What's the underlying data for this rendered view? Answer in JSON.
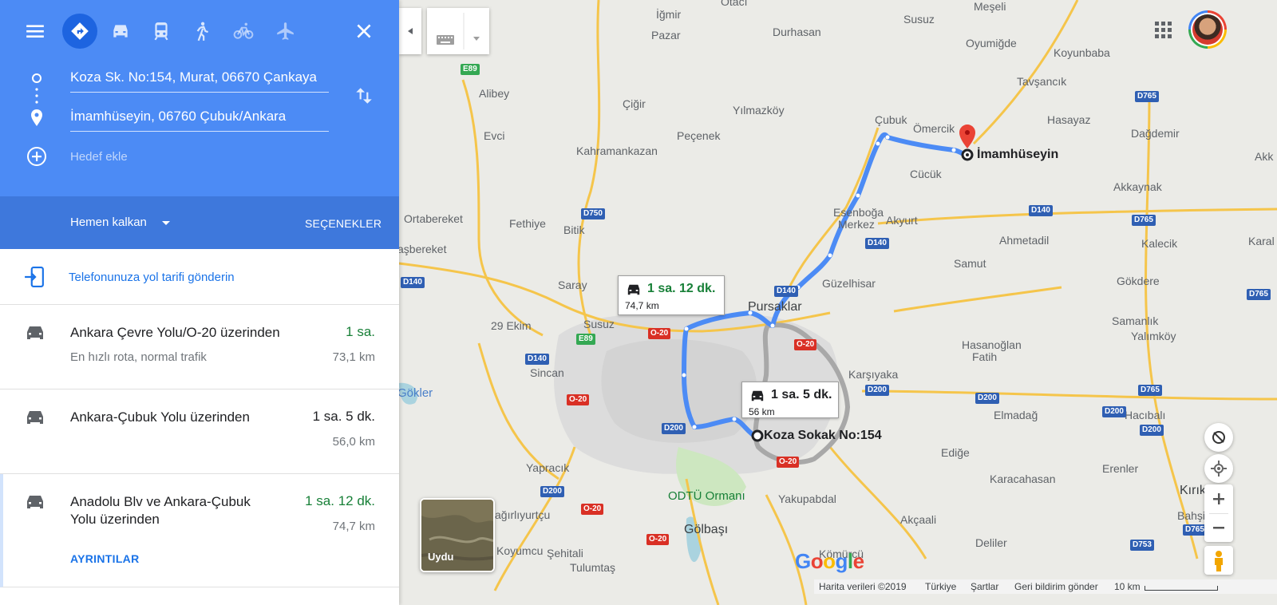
{
  "panel": {
    "origin_field": "Koza Sk. No:154, Murat, 06670 Çankaya",
    "destination_field": "İmamhüseyin, 06760 Çubuk/Ankara",
    "add_destination_placeholder": "Hedef ekle",
    "depart_label": "Hemen kalkan",
    "options_label": "SEÇENEKLER",
    "send_to_phone": "Telefonunuza yol tarifi gönderin",
    "routes": [
      {
        "name": "Ankara Çevre Yolu/O-20 üzerinden",
        "time": "1 sa.",
        "description": "En hızlı rota, normal trafik",
        "distance": "73,1 km"
      },
      {
        "name": "Ankara-Çubuk Yolu üzerinden",
        "time": "1 sa. 5 dk.",
        "description": "",
        "distance": "56,0 km"
      },
      {
        "name_line1": "Anadolu Blv ve Ankara-Çubuk",
        "name_line2": "Yolu üzerinden",
        "time": "1 sa. 12 dk.",
        "distance": "74,7 km",
        "details_label": "AYRINTILAR"
      }
    ],
    "modes": [
      "directions-icon",
      "car-icon",
      "transit-icon",
      "walk-icon",
      "bicycle-icon",
      "flight-icon"
    ]
  },
  "map": {
    "places": {
      "igmir": "İğmir",
      "otaci": "Otacı",
      "susuz": "Susuz",
      "mesel": "Meşeli",
      "pazar": "Pazar",
      "durhasan": "Durhasan",
      "oyumlu": "Oyumiğde",
      "koyun": "Koyunbaba",
      "alibey": "Alibey",
      "cigir": "Çiğir",
      "yilmaz": "Yılmazköy",
      "tavsan": "Tavşancık",
      "cubuk": "Çubuk",
      "omercik": "Ömercik",
      "hasayaz": "Hasayaz",
      "dagdemir": "Dağdemir",
      "evci": "Evci",
      "pecenek": "Peçenek",
      "kahraman": "Kahramankazan",
      "cucuk": "Cücük",
      "akka": "Akk",
      "akkaynak": "Akkaynak",
      "orta": "Ortabereket",
      "fethiye": "Fethiye",
      "bitik": "Bitik",
      "esenboga": "Esenboğa",
      "merkez": "Merkez",
      "akyurt": "Akyurt",
      "ahmetadil": "Ahmetadil",
      "kalecik": "Kalecik",
      "kara": "Karal",
      "asbereket": "aşbereket",
      "samut": "Samut",
      "saray": "Saray",
      "guzelhisar": "Güzelhisar",
      "gokdere": "Gökdere",
      "pursaklar": "Pursaklar",
      "ekim": "29 Ekim",
      "susuz2": "Susuz",
      "samanlik": "Samanlık",
      "hasanoglan": "Hasanoğlan",
      "fatih": "Fatih",
      "yalim": "Yalımköy",
      "sincan": "Sincan",
      "karsiyaka": "Karşıyaka",
      "gokler": "Gökler",
      "elmadag": "Elmadağ",
      "hacibali": "Hacıbalı",
      "yaprak": "Yapracık",
      "edige": "Ediğe",
      "erenler": "Erenler",
      "karaca": "Karacahasan",
      "kirik": "Kırık",
      "odtu": "ODTÜ Ormanı",
      "yakup": "Yakupabdal",
      "bahsili": "Bahşili",
      "sagir": "ağırlıyurtçu",
      "akcaali": "Akçaali",
      "golbasi": "Gölbaşı",
      "koyumcu": "Koyumcu",
      "sehitali": "Şehitali",
      "tulum": "Tulumtaş",
      "komurcu": "Kömürcü",
      "deliler": "Deliler",
      "imam": "İmamhüseyin",
      "koza": "Koza Sokak No:154"
    },
    "shields": [
      "E89",
      "D750",
      "D140",
      "D765",
      "O-20",
      "D200",
      "D753"
    ],
    "bubble_alt": {
      "time": "1 sa. 12 dk.",
      "distance": "74,7 km"
    },
    "bubble_main": {
      "time": "1 sa. 5 dk.",
      "distance": "56 km"
    },
    "satellite_label": "Uydu",
    "google_logo": "Google",
    "footer": {
      "data": "Harita verileri ©2019",
      "country": "Türkiye",
      "terms": "Şartlar",
      "feedback": "Geri bildirim gönder",
      "scale": "10 km"
    },
    "colors": {
      "route": "#4c8bf5",
      "alt_route": "#a8a8a8",
      "highway": "#f5c54b",
      "green_time": "#188038"
    }
  }
}
